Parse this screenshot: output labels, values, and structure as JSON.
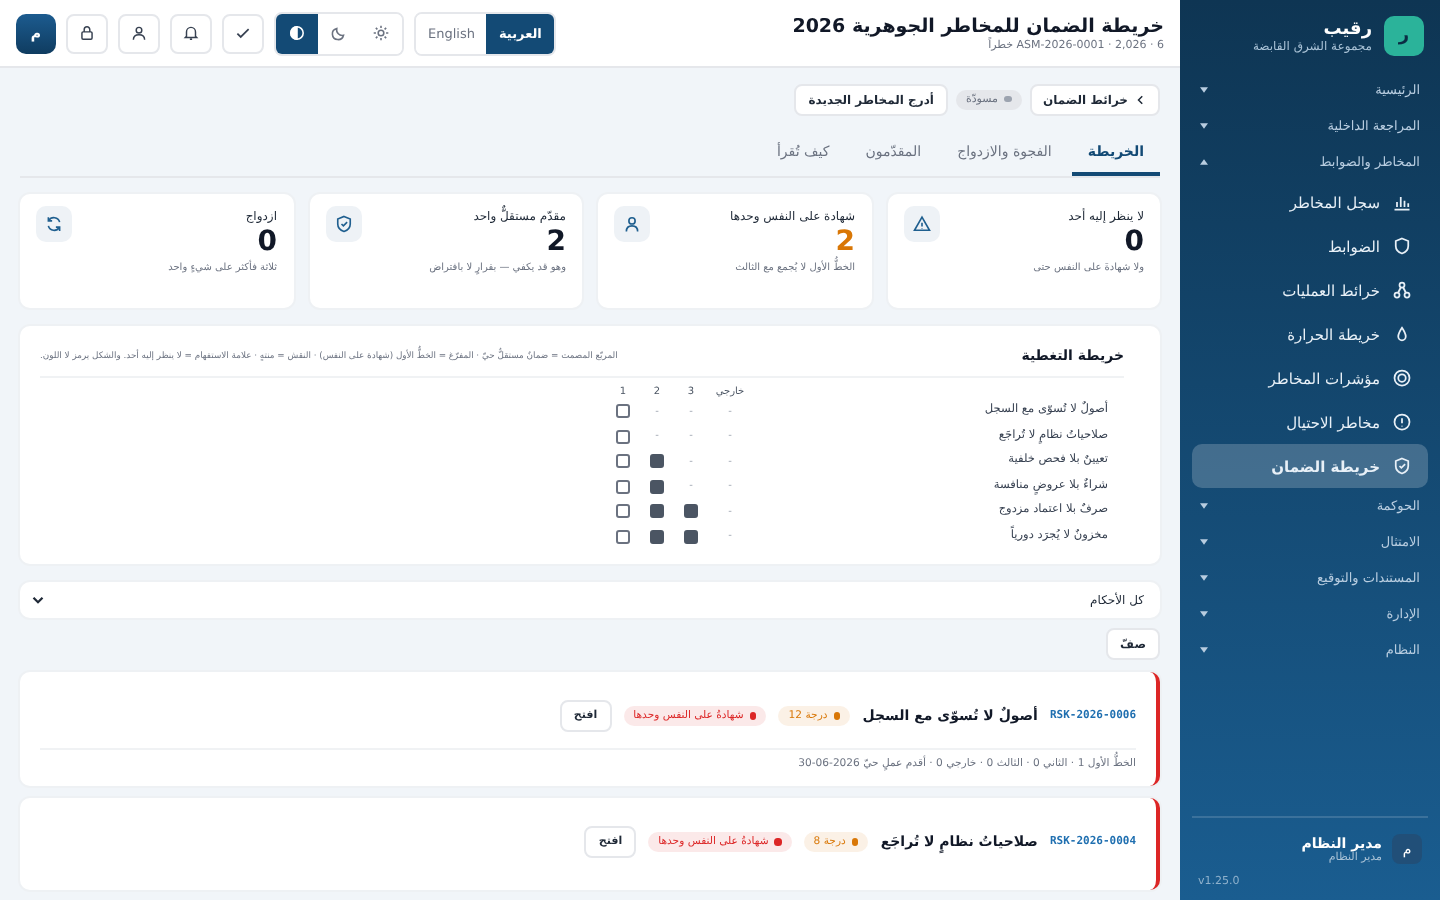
{
  "sidebar": {
    "logo": "ر",
    "brand": "رقيب",
    "org": "مجموعة الشرق القابضة",
    "groups": [
      {
        "label": "الرئيسية",
        "expanded": false
      },
      {
        "label": "المراجعة الداخلية",
        "expanded": false
      },
      {
        "label": "المخاطر والضوابط",
        "expanded": true,
        "children": [
          {
            "label": "سجل المخاطر",
            "kind": "chart",
            "selected": false
          },
          {
            "label": "الضوابط",
            "kind": "shield",
            "selected": false
          },
          {
            "label": "خرائط العمليات",
            "kind": "nodes",
            "selected": false
          },
          {
            "label": "خريطة الحرارة",
            "kind": "drop",
            "selected": false
          },
          {
            "label": "مؤشرات المخاطر",
            "kind": "gauge",
            "selected": false
          },
          {
            "label": "مخاطر الاحتيال",
            "kind": "alert",
            "selected": false
          },
          {
            "label": "خريطة الضمان",
            "kind": "shieldcheck",
            "selected": true
          }
        ]
      },
      {
        "label": "الحوكمة",
        "expanded": false
      },
      {
        "label": "الامتثال",
        "expanded": false
      },
      {
        "label": "المستندات والتوقيع",
        "expanded": false
      },
      {
        "label": "الإدارة",
        "expanded": false
      },
      {
        "label": "النظام",
        "expanded": false
      }
    ],
    "user": {
      "avatar": "م",
      "name": "مدير النظام",
      "role": "مدير النظام"
    },
    "version": "v1.25.0"
  },
  "header": {
    "title": "خريطة الضمان للمخاطر الجوهرية 2026",
    "subtitle": "ASM-2026-0001 · 2,026 · 6 خطراً",
    "languages": [
      {
        "label": "العربية",
        "selected": true
      },
      {
        "label": "English",
        "selected": false
      }
    ],
    "themes": [
      {
        "kind": "sun",
        "selected": false
      },
      {
        "kind": "moon",
        "selected": false
      },
      {
        "kind": "contrast",
        "selected": true
      }
    ],
    "avatar": "م"
  },
  "breadcrumb": {
    "back": "خرائط الضمان",
    "status": "مسودّة",
    "action": "أدرج المخاطر الجديدة"
  },
  "tabs": [
    {
      "label": "الخريطة",
      "selected": true
    },
    {
      "label": "الفجوة والازدواج",
      "selected": false
    },
    {
      "label": "المقدّمون",
      "selected": false
    },
    {
      "label": "كيف تُقرأ",
      "selected": false
    }
  ],
  "stats": [
    {
      "label": "لا ينظر إليه أحد",
      "value": "0",
      "color": "#111827",
      "note": "ولا شهادةَ على النفس حتى",
      "kind": "warning"
    },
    {
      "label": "شهادة على النفس وحدها",
      "value": "2",
      "color": "#d97706",
      "note": "الخطُّ الأول لا يُجمع مع الثالث",
      "kind": "person"
    },
    {
      "label": "مقدّم مستقلٌّ واحد",
      "value": "2",
      "color": "#111827",
      "note": "وهو قد يكفي — بقرارٍ لا بافتراض",
      "kind": "shield"
    },
    {
      "label": "ازدواج",
      "value": "0",
      "color": "#111827",
      "note": "ثلاثة فأكثر على شيءٍ واحد",
      "kind": "refresh"
    }
  ],
  "coverage": {
    "title": "خريطة التغطية",
    "legend": "المربّع المصمت = ضمانٌ مستقلٌّ حيّ · المفرّغ = الخطُّ الأول (شهادة على النفس) · النقش = منتهٍ · علامة الاستفهام = لا ينظر إليه أحد. والشكل يرمز لا اللون.",
    "columns": [
      "خارجي",
      "3",
      "2",
      "1"
    ],
    "rows": [
      {
        "label": "أصولٌ لا تُسوّى مع السجل",
        "cells": [
          {
            "kind": "dash",
            "text": "-"
          },
          {
            "kind": "dash",
            "text": "-"
          },
          {
            "kind": "dash",
            "text": "-"
          },
          {
            "kind": "square",
            "filled": false
          }
        ]
      },
      {
        "label": "صلاحياتُ نظامٍ لا تُراجَع",
        "cells": [
          {
            "kind": "dash",
            "text": "-"
          },
          {
            "kind": "dash",
            "text": "-"
          },
          {
            "kind": "dash",
            "text": "-"
          },
          {
            "kind": "square",
            "filled": false
          }
        ]
      },
      {
        "label": "تعيينٌ بلا فحص خلفية",
        "cells": [
          {
            "kind": "dash",
            "text": "-"
          },
          {
            "kind": "dash",
            "text": "-"
          },
          {
            "kind": "square",
            "filled": true
          },
          {
            "kind": "square",
            "filled": false
          }
        ]
      },
      {
        "label": "شراءٌ بلا عروضٍ منافسة",
        "cells": [
          {
            "kind": "dash",
            "text": "-"
          },
          {
            "kind": "dash",
            "text": "-"
          },
          {
            "kind": "square",
            "filled": true
          },
          {
            "kind": "square",
            "filled": false
          }
        ]
      },
      {
        "label": "صرفٌ بلا اعتماد مزدوج",
        "cells": [
          {
            "kind": "dash",
            "text": "-"
          },
          {
            "kind": "square",
            "filled": true
          },
          {
            "kind": "square",
            "filled": true
          },
          {
            "kind": "square",
            "filled": false
          }
        ]
      },
      {
        "label": "مخزونٌ لا يُجرَد دورياً",
        "cells": [
          {
            "kind": "dash",
            "text": "-"
          },
          {
            "kind": "square",
            "filled": true
          },
          {
            "kind": "square",
            "filled": true
          },
          {
            "kind": "square",
            "filled": false
          }
        ]
      }
    ]
  },
  "filter": {
    "value": "كل الأحكام"
  },
  "sort_button": "صفّ",
  "risks": [
    {
      "id": "RSK-2026-0006",
      "title": "أصولٌ لا تُسوّى مع السجل",
      "badges": [
        {
          "text": "درجة 12",
          "color": "#d97706"
        },
        {
          "text": "شهادةُ على النفس وحدها",
          "color": "#dc2626"
        }
      ],
      "open": "افتح",
      "meta": "الخطُّ الأول 1 · الثاني 0 · الثالث 0 · خارجي 0 · أقدم عملٍ حيّ 2026-06-30"
    },
    {
      "id": "RSK-2026-0004",
      "title": "صلاحياتُ نظامٍ لا تُراجَع",
      "badges": [
        {
          "text": "درجة 8",
          "color": "#d97706"
        },
        {
          "text": "شهادةُ على النفس وحدها",
          "color": "#dc2626"
        }
      ],
      "open": "افتح"
    }
  ]
}
